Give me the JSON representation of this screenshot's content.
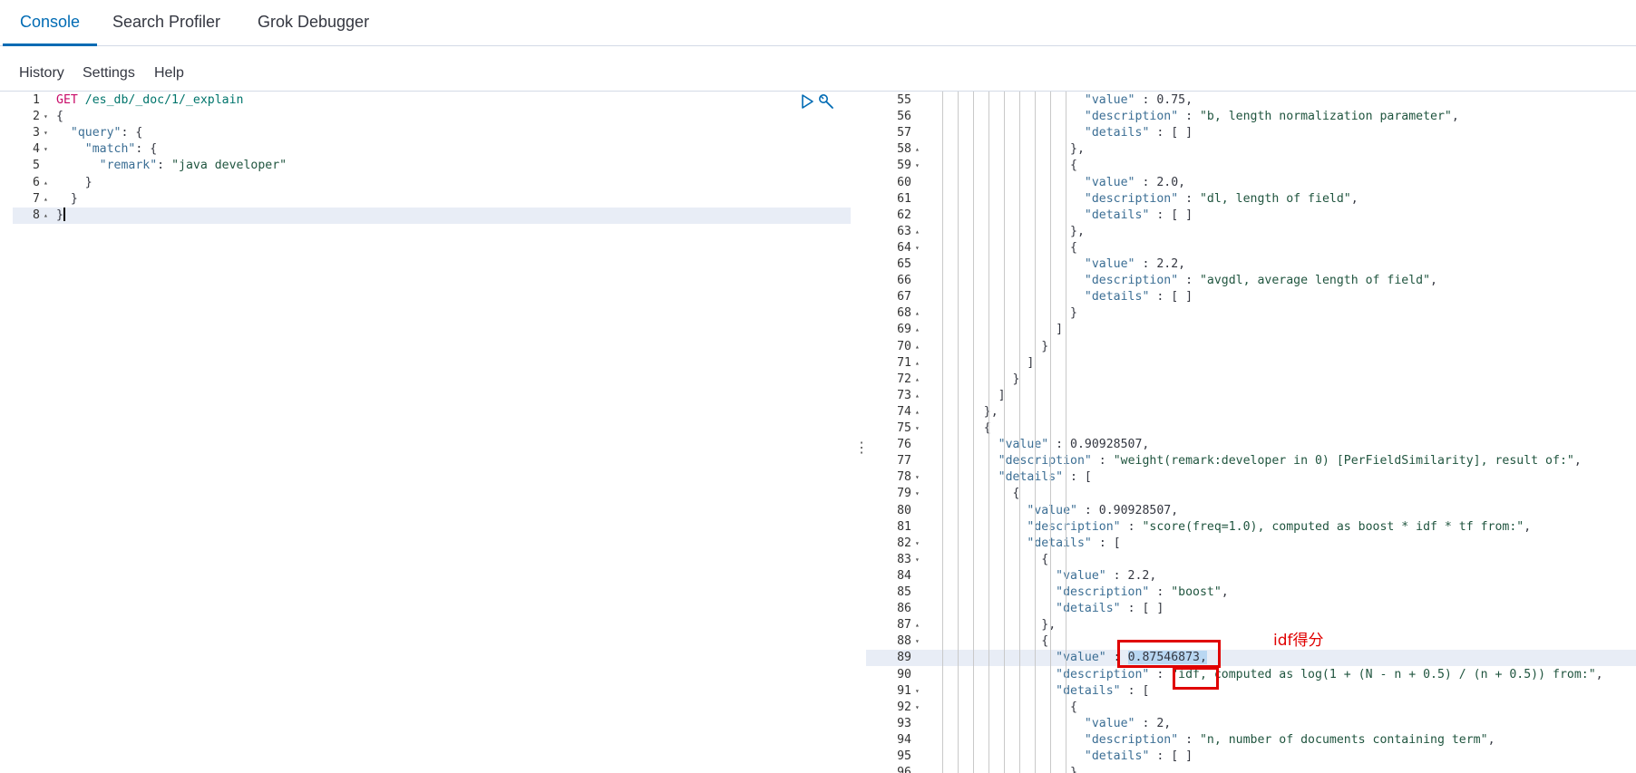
{
  "tabs": [
    "Console",
    "Search Profiler",
    "Grok Debugger"
  ],
  "menu": [
    "History",
    "Settings",
    "Help"
  ],
  "request": {
    "lines": [
      {
        "n": "1",
        "fold": "",
        "text": [
          [
            "method",
            "GET"
          ],
          [
            "plain",
            " "
          ],
          [
            "url",
            "/es_db/_doc/1/_explain"
          ]
        ]
      },
      {
        "n": "2",
        "fold": "▾",
        "text": [
          [
            "plain",
            "{"
          ]
        ]
      },
      {
        "n": "3",
        "fold": "▾",
        "text": [
          [
            "plain",
            "  "
          ],
          [
            "key",
            "\"query\""
          ],
          [
            "plain",
            ": {"
          ]
        ]
      },
      {
        "n": "4",
        "fold": "▾",
        "text": [
          [
            "plain",
            "    "
          ],
          [
            "key",
            "\"match\""
          ],
          [
            "plain",
            ": {"
          ]
        ]
      },
      {
        "n": "5",
        "fold": "",
        "text": [
          [
            "plain",
            "      "
          ],
          [
            "key",
            "\"remark\""
          ],
          [
            "plain",
            ": "
          ],
          [
            "str",
            "\"java developer\""
          ]
        ]
      },
      {
        "n": "6",
        "fold": "▴",
        "text": [
          [
            "plain",
            "    }"
          ]
        ]
      },
      {
        "n": "7",
        "fold": "▴",
        "text": [
          [
            "plain",
            "  }"
          ]
        ]
      },
      {
        "n": "8",
        "fold": "▴",
        "text": [
          [
            "plain",
            "}"
          ]
        ]
      }
    ]
  },
  "response": {
    "lines": [
      {
        "n": "55",
        "fold": "",
        "text": [
          [
            "plain",
            "                  "
          ],
          [
            "key",
            "\"value\""
          ],
          [
            "plain",
            " : 0.75,"
          ]
        ]
      },
      {
        "n": "56",
        "fold": "",
        "text": [
          [
            "plain",
            "                  "
          ],
          [
            "key",
            "\"description\""
          ],
          [
            "plain",
            " : "
          ],
          [
            "str",
            "\"b, length normalization parameter\""
          ],
          [
            "plain",
            ","
          ]
        ]
      },
      {
        "n": "57",
        "fold": "",
        "text": [
          [
            "plain",
            "                  "
          ],
          [
            "key",
            "\"details\""
          ],
          [
            "plain",
            " : [ ]"
          ]
        ]
      },
      {
        "n": "58",
        "fold": "▴",
        "text": [
          [
            "plain",
            "                },"
          ]
        ]
      },
      {
        "n": "59",
        "fold": "▾",
        "text": [
          [
            "plain",
            "                {"
          ]
        ]
      },
      {
        "n": "60",
        "fold": "",
        "text": [
          [
            "plain",
            "                  "
          ],
          [
            "key",
            "\"value\""
          ],
          [
            "plain",
            " : 2.0,"
          ]
        ]
      },
      {
        "n": "61",
        "fold": "",
        "text": [
          [
            "plain",
            "                  "
          ],
          [
            "key",
            "\"description\""
          ],
          [
            "plain",
            " : "
          ],
          [
            "str",
            "\"dl, length of field\""
          ],
          [
            "plain",
            ","
          ]
        ]
      },
      {
        "n": "62",
        "fold": "",
        "text": [
          [
            "plain",
            "                  "
          ],
          [
            "key",
            "\"details\""
          ],
          [
            "plain",
            " : [ ]"
          ]
        ]
      },
      {
        "n": "63",
        "fold": "▴",
        "text": [
          [
            "plain",
            "                },"
          ]
        ]
      },
      {
        "n": "64",
        "fold": "▾",
        "text": [
          [
            "plain",
            "                {"
          ]
        ]
      },
      {
        "n": "65",
        "fold": "",
        "text": [
          [
            "plain",
            "                  "
          ],
          [
            "key",
            "\"value\""
          ],
          [
            "plain",
            " : 2.2,"
          ]
        ]
      },
      {
        "n": "66",
        "fold": "",
        "text": [
          [
            "plain",
            "                  "
          ],
          [
            "key",
            "\"description\""
          ],
          [
            "plain",
            " : "
          ],
          [
            "str",
            "\"avgdl, average length of field\""
          ],
          [
            "plain",
            ","
          ]
        ]
      },
      {
        "n": "67",
        "fold": "",
        "text": [
          [
            "plain",
            "                  "
          ],
          [
            "key",
            "\"details\""
          ],
          [
            "plain",
            " : [ ]"
          ]
        ]
      },
      {
        "n": "68",
        "fold": "▴",
        "text": [
          [
            "plain",
            "                }"
          ]
        ]
      },
      {
        "n": "69",
        "fold": "▴",
        "text": [
          [
            "plain",
            "              ]"
          ]
        ]
      },
      {
        "n": "70",
        "fold": "▴",
        "text": [
          [
            "plain",
            "            }"
          ]
        ]
      },
      {
        "n": "71",
        "fold": "▴",
        "text": [
          [
            "plain",
            "          ]"
          ]
        ]
      },
      {
        "n": "72",
        "fold": "▴",
        "text": [
          [
            "plain",
            "        }"
          ]
        ]
      },
      {
        "n": "73",
        "fold": "▴",
        "text": [
          [
            "plain",
            "      ]"
          ]
        ]
      },
      {
        "n": "74",
        "fold": "▴",
        "text": [
          [
            "plain",
            "    },"
          ]
        ]
      },
      {
        "n": "75",
        "fold": "▾",
        "text": [
          [
            "plain",
            "    {"
          ]
        ]
      },
      {
        "n": "76",
        "fold": "",
        "text": [
          [
            "plain",
            "      "
          ],
          [
            "key",
            "\"value\""
          ],
          [
            "plain",
            " : 0.90928507,"
          ]
        ]
      },
      {
        "n": "77",
        "fold": "",
        "text": [
          [
            "plain",
            "      "
          ],
          [
            "key",
            "\"description\""
          ],
          [
            "plain",
            " : "
          ],
          [
            "str",
            "\"weight(remark:developer in 0) [PerFieldSimilarity], result of:\""
          ],
          [
            "plain",
            ","
          ]
        ]
      },
      {
        "n": "78",
        "fold": "▾",
        "text": [
          [
            "plain",
            "      "
          ],
          [
            "key",
            "\"details\""
          ],
          [
            "plain",
            " : ["
          ]
        ]
      },
      {
        "n": "79",
        "fold": "▾",
        "text": [
          [
            "plain",
            "        {"
          ]
        ]
      },
      {
        "n": "80",
        "fold": "",
        "text": [
          [
            "plain",
            "          "
          ],
          [
            "key",
            "\"value\""
          ],
          [
            "plain",
            " : 0.90928507,"
          ]
        ]
      },
      {
        "n": "81",
        "fold": "",
        "text": [
          [
            "plain",
            "          "
          ],
          [
            "key",
            "\"description\""
          ],
          [
            "plain",
            " : "
          ],
          [
            "str",
            "\"score(freq=1.0), computed as boost * idf * tf from:\""
          ],
          [
            "plain",
            ","
          ]
        ]
      },
      {
        "n": "82",
        "fold": "▾",
        "text": [
          [
            "plain",
            "          "
          ],
          [
            "key",
            "\"details\""
          ],
          [
            "plain",
            " : ["
          ]
        ]
      },
      {
        "n": "83",
        "fold": "▾",
        "text": [
          [
            "plain",
            "            {"
          ]
        ]
      },
      {
        "n": "84",
        "fold": "",
        "text": [
          [
            "plain",
            "              "
          ],
          [
            "key",
            "\"value\""
          ],
          [
            "plain",
            " : 2.2,"
          ]
        ]
      },
      {
        "n": "85",
        "fold": "",
        "text": [
          [
            "plain",
            "              "
          ],
          [
            "key",
            "\"description\""
          ],
          [
            "plain",
            " : "
          ],
          [
            "str",
            "\"boost\""
          ],
          [
            "plain",
            ","
          ]
        ]
      },
      {
        "n": "86",
        "fold": "",
        "text": [
          [
            "plain",
            "              "
          ],
          [
            "key",
            "\"details\""
          ],
          [
            "plain",
            " : [ ]"
          ]
        ]
      },
      {
        "n": "87",
        "fold": "▴",
        "text": [
          [
            "plain",
            "            },"
          ]
        ]
      },
      {
        "n": "88",
        "fold": "▾",
        "text": [
          [
            "plain",
            "            {"
          ]
        ]
      },
      {
        "n": "89",
        "fold": "",
        "text": [
          [
            "plain",
            "              "
          ],
          [
            "key",
            "\"value\""
          ],
          [
            "plain",
            " : "
          ],
          [
            "sel",
            "0.87546873,"
          ]
        ]
      },
      {
        "n": "90",
        "fold": "",
        "text": [
          [
            "plain",
            "              "
          ],
          [
            "key",
            "\"description\""
          ],
          [
            "plain",
            " : "
          ],
          [
            "str",
            "\"idf, computed as log(1 + (N - n + 0.5) / (n + 0.5)) from:\""
          ],
          [
            "plain",
            ","
          ]
        ]
      },
      {
        "n": "91",
        "fold": "▾",
        "text": [
          [
            "plain",
            "              "
          ],
          [
            "key",
            "\"details\""
          ],
          [
            "plain",
            " : ["
          ]
        ]
      },
      {
        "n": "92",
        "fold": "▾",
        "text": [
          [
            "plain",
            "                {"
          ]
        ]
      },
      {
        "n": "93",
        "fold": "",
        "text": [
          [
            "plain",
            "                  "
          ],
          [
            "key",
            "\"value\""
          ],
          [
            "plain",
            " : 2,"
          ]
        ]
      },
      {
        "n": "94",
        "fold": "",
        "text": [
          [
            "plain",
            "                  "
          ],
          [
            "key",
            "\"description\""
          ],
          [
            "plain",
            " : "
          ],
          [
            "str",
            "\"n, number of documents containing term\""
          ],
          [
            "plain",
            ","
          ]
        ]
      },
      {
        "n": "95",
        "fold": "",
        "text": [
          [
            "plain",
            "                  "
          ],
          [
            "key",
            "\"details\""
          ],
          [
            "plain",
            " : [ ]"
          ]
        ]
      },
      {
        "n": "96",
        "fold": "",
        "text": [
          [
            "plain",
            "                },"
          ]
        ]
      }
    ]
  },
  "annotation": {
    "label": "idf得分"
  },
  "icons": {
    "run": "play-icon",
    "settings": "wrench-icon",
    "splitter": "vertical-ellipsis-icon"
  }
}
